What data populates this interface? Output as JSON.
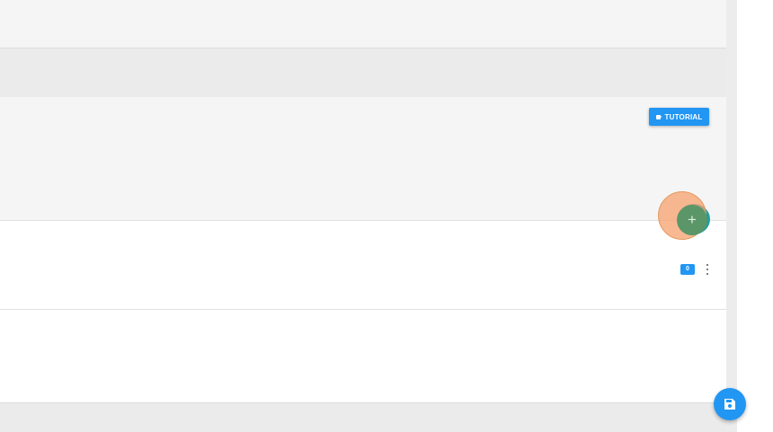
{
  "toolbar": {
    "tutorial_label": "TUTORIAL",
    "tutorial_icon": "video-camera-icon"
  },
  "fab": {
    "add_symbol": "+",
    "add_icon": "plus-icon",
    "halo_color": "#f5a06e",
    "color": "#5b9668"
  },
  "list": {
    "rows": [
      {
        "count": "0",
        "menu_icon": "more-vert-icon"
      },
      {}
    ]
  },
  "save": {
    "icon": "save-icon",
    "color": "#2196f3"
  },
  "colors": {
    "accent": "#2196f3"
  }
}
